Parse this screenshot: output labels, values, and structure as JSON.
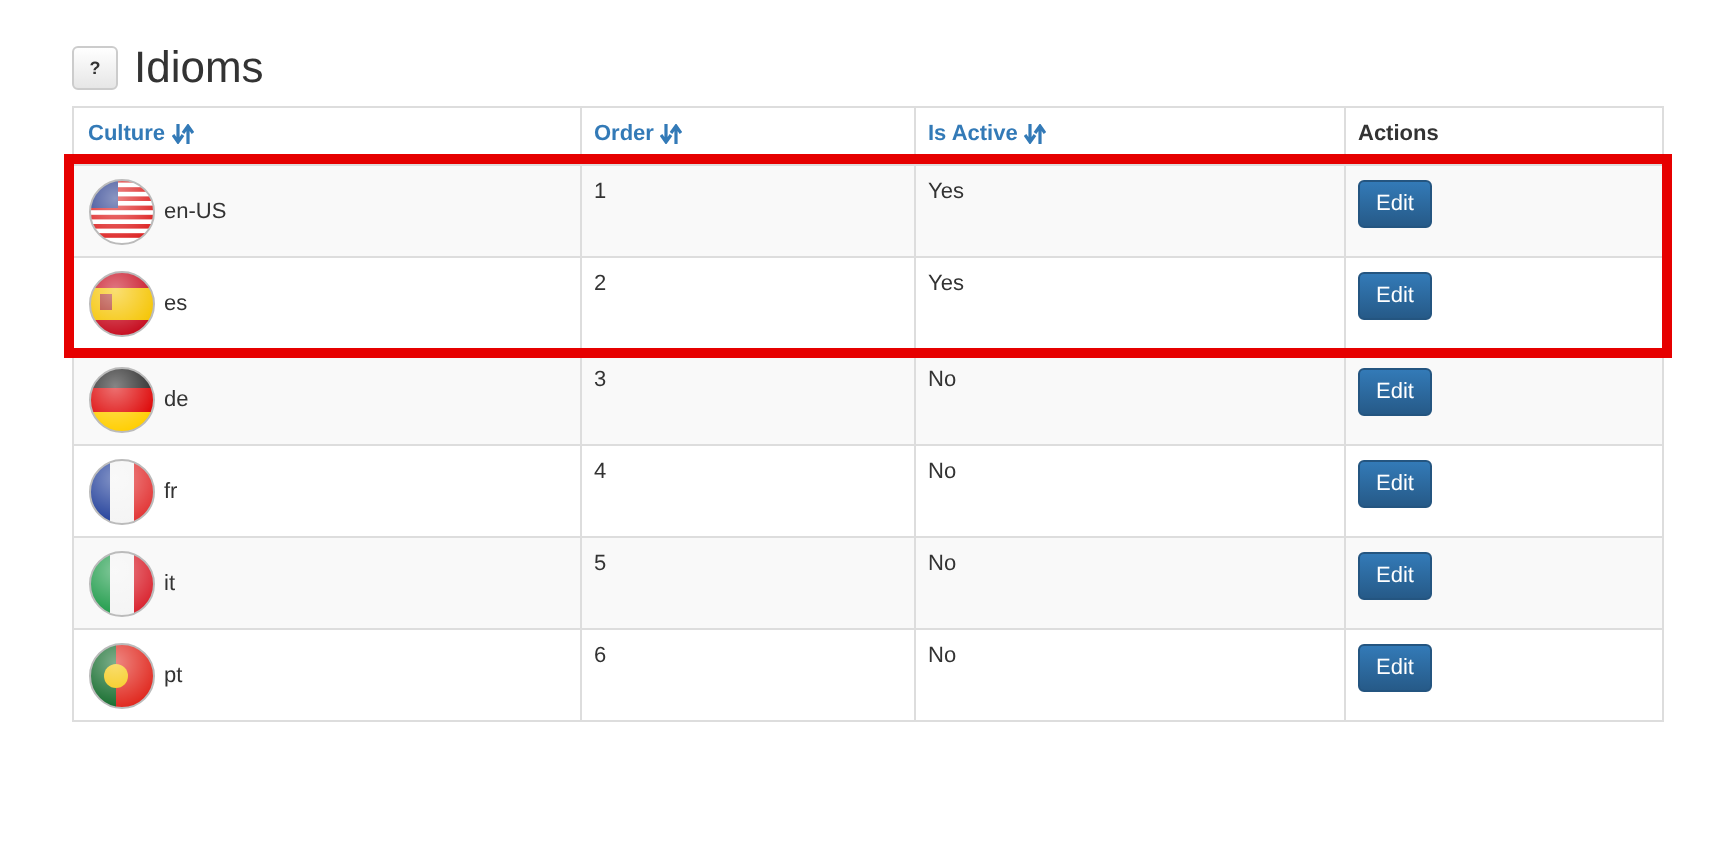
{
  "header": {
    "help_button": "?",
    "title": "Idioms"
  },
  "table": {
    "columns": [
      {
        "label": "Culture",
        "sortable": true
      },
      {
        "label": "Order",
        "sortable": true
      },
      {
        "label": "Is Active",
        "sortable": true
      },
      {
        "label": "Actions",
        "sortable": false
      }
    ],
    "rows": [
      {
        "kind": "us",
        "culture": "en-US",
        "order": "1",
        "active": "Yes",
        "action": "Edit",
        "highlighted": true
      },
      {
        "kind": "es",
        "culture": "es",
        "order": "2",
        "active": "Yes",
        "action": "Edit",
        "highlighted": true
      },
      {
        "kind": "de",
        "culture": "de",
        "order": "3",
        "active": "No",
        "action": "Edit",
        "highlighted": false
      },
      {
        "kind": "fr",
        "culture": "fr",
        "order": "4",
        "active": "No",
        "action": "Edit",
        "highlighted": false
      },
      {
        "kind": "it",
        "culture": "it",
        "order": "5",
        "active": "No",
        "action": "Edit",
        "highlighted": false
      },
      {
        "kind": "pt",
        "culture": "pt",
        "order": "6",
        "active": "No",
        "action": "Edit",
        "highlighted": false
      }
    ]
  }
}
